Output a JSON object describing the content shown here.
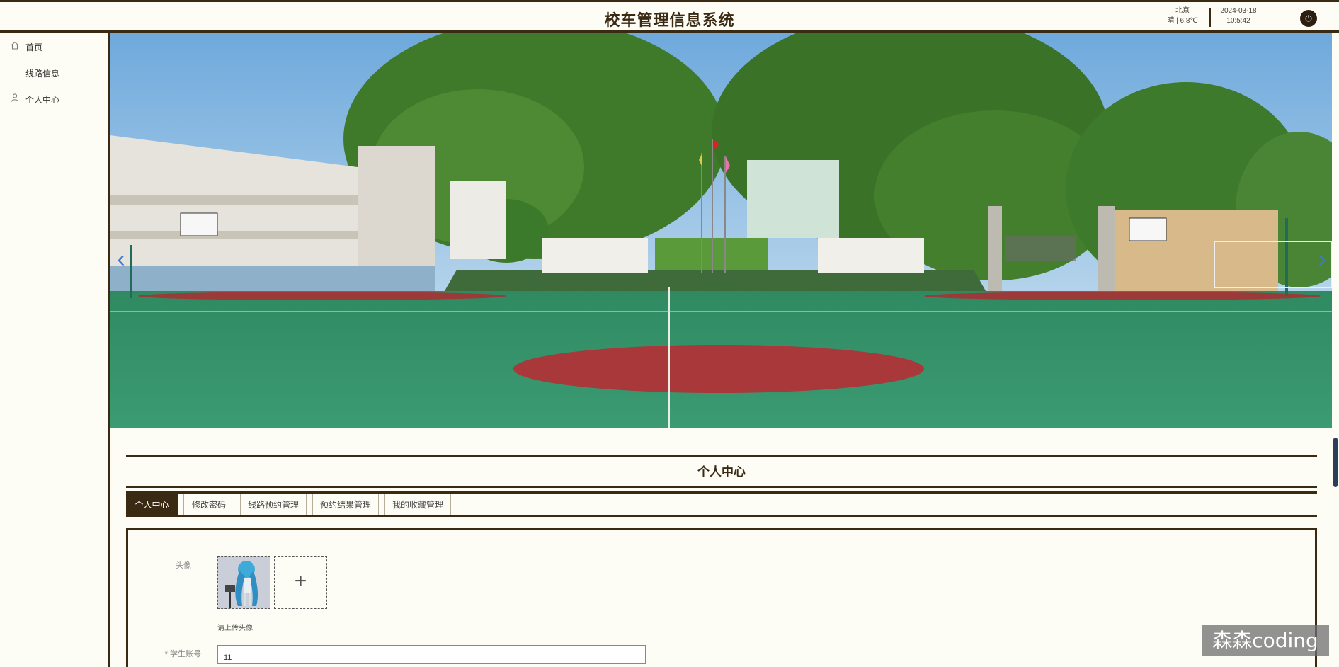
{
  "header": {
    "title": "校车管理信息系统",
    "weather_city": "北京",
    "weather_desc": "晴 | 6.8℃",
    "date": "2024-03-18",
    "time": "10:5:42"
  },
  "sidebar": {
    "items": [
      {
        "label": "首页",
        "icon": "home-icon"
      },
      {
        "label": "线路信息",
        "icon": ""
      },
      {
        "label": "个人中心",
        "icon": "user-icon"
      }
    ]
  },
  "section": {
    "title": "个人中心",
    "tabs": [
      {
        "label": "个人中心",
        "active": true
      },
      {
        "label": "修改密码",
        "active": false
      },
      {
        "label": "线路预约管理",
        "active": false
      },
      {
        "label": "预约结果管理",
        "active": false
      },
      {
        "label": "我的收藏管理",
        "active": false
      }
    ]
  },
  "form": {
    "avatar_label": "头像",
    "upload_hint": "请上传头像",
    "account_label": "* 学生账号",
    "account_value": "11"
  },
  "watermark": "森森coding",
  "colors": {
    "accent": "#3a2a14",
    "background": "#fdfdf6",
    "carousel_arrow": "#3a7bd5"
  }
}
